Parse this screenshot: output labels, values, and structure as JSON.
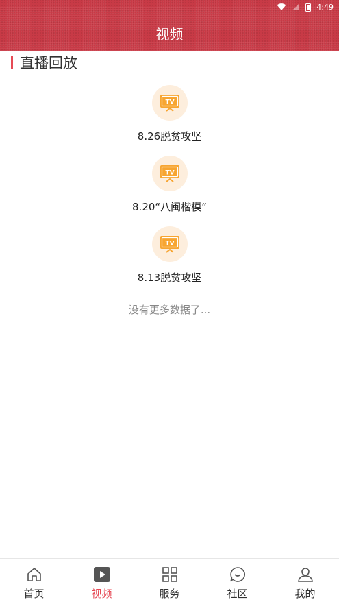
{
  "status_bar": {
    "time": "4:49"
  },
  "header": {
    "title": "视频"
  },
  "section": {
    "title": "直播回放"
  },
  "videos": [
    {
      "label": "8.26脱贫攻坚",
      "badge": "TV"
    },
    {
      "label": "8.20“八闽楷模”",
      "badge": "TV"
    },
    {
      "label": "8.13脱贫攻坚",
      "badge": "TV"
    }
  ],
  "footer_text": "没有更多数据了...",
  "tabs": [
    {
      "label": "首页",
      "icon": "home-icon"
    },
    {
      "label": "视频",
      "icon": "video-play-icon",
      "active": true
    },
    {
      "label": "服务",
      "icon": "grid-icon"
    },
    {
      "label": "社区",
      "icon": "chat-bubble-icon"
    },
    {
      "label": "我的",
      "icon": "user-icon"
    }
  ],
  "colors": {
    "header": "#c83a46",
    "accent": "#e64a55",
    "tv_icon": "#f7a531",
    "tv_bg": "#fdeedd"
  }
}
